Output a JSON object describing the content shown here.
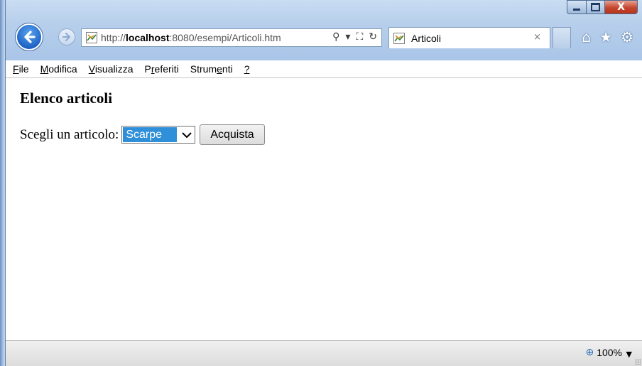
{
  "browser": {
    "address": {
      "scheme": "http://",
      "host": "localhost",
      "rest": ":8080/esempi/Articoli.htm"
    },
    "tab": {
      "title": "Articoli"
    },
    "icons": {
      "back": "back-arrow-icon",
      "forward": "forward-arrow-icon",
      "search": "search-icon",
      "compat": "compatibility-view-icon",
      "refresh": "refresh-icon",
      "home": "home-icon",
      "favorites": "star-icon",
      "tools": "gear-icon"
    },
    "glyphs": {
      "search": "⚲",
      "search_drop": "▾",
      "compat": "⛶",
      "refresh": "↻",
      "tab_close": "×",
      "home": "⌂",
      "favorites": "★",
      "tools": "⚙",
      "close": "X",
      "zoom_icon": "⊕",
      "zoom_drop": "▼"
    }
  },
  "menu": {
    "items": [
      {
        "label": "File",
        "underline": "F",
        "rest": "ile"
      },
      {
        "label": "Modifica",
        "underline": "M",
        "rest": "odifica"
      },
      {
        "label": "Visualizza",
        "underline": "V",
        "rest": "isualizza"
      },
      {
        "label": "Preferiti",
        "pre": "P",
        "underline": "r",
        "rest": "eferiti"
      },
      {
        "label": "Strumenti",
        "pre": "Strum",
        "underline": "e",
        "rest": "nti"
      },
      {
        "label": "?",
        "underline": "?",
        "rest": ""
      }
    ]
  },
  "page": {
    "heading": "Elenco articoli",
    "form": {
      "label": "Scegli un articolo:",
      "select_value": "Scarpe",
      "button_label": "Acquista"
    }
  },
  "status": {
    "zoom": "100%"
  },
  "colors": {
    "accent": "#2f8fd8",
    "chrome": "#b7cfeb",
    "close_button": "#c4462e"
  }
}
